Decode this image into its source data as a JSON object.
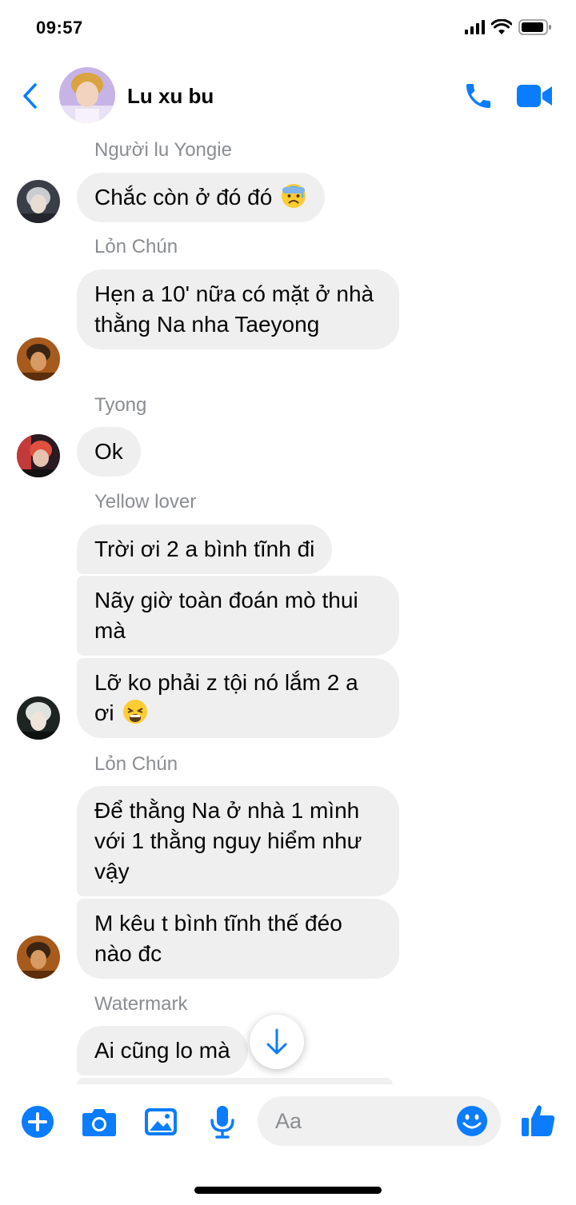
{
  "status_bar": {
    "time": "09:57"
  },
  "header": {
    "title": "Lu xu bu"
  },
  "messages": [
    {
      "sender": "Người lu Yongie",
      "bubbles": [
        "Chắc còn ở đó đó"
      ],
      "emoji": "anxious-sweat-emoji"
    },
    {
      "sender": "Lỏn Chún",
      "bubbles": [
        "Hẹn a 10' nữa có mặt ở nhà thằng Na nha Taeyong"
      ]
    },
    {
      "sender": "Tyong",
      "bubbles": [
        "Ok"
      ]
    },
    {
      "sender": "Yellow lover",
      "bubbles": [
        "Trời ơi 2 a bình tĩnh đi",
        "Nãy giờ toàn đoán mò thui mà",
        "Lỡ ko phải z tội nó lắm 2 a ơi"
      ],
      "emoji": "weary-face-emoji"
    },
    {
      "sender": "Lỏn Chún",
      "bubbles": [
        "Để thằng Na ở nhà 1 mình với 1 thằng nguy hiểm như vậy",
        "M kêu t bình tĩnh thế đéo nào đc"
      ]
    },
    {
      "sender": "Watermark",
      "bubbles": [
        "Ai cũng lo mà"
      ]
    }
  ],
  "composer": {
    "placeholder": "Aa"
  },
  "colors": {
    "accent": "#0a7cff",
    "bubble": "#efefef",
    "sender_text": "#8a8d91"
  }
}
